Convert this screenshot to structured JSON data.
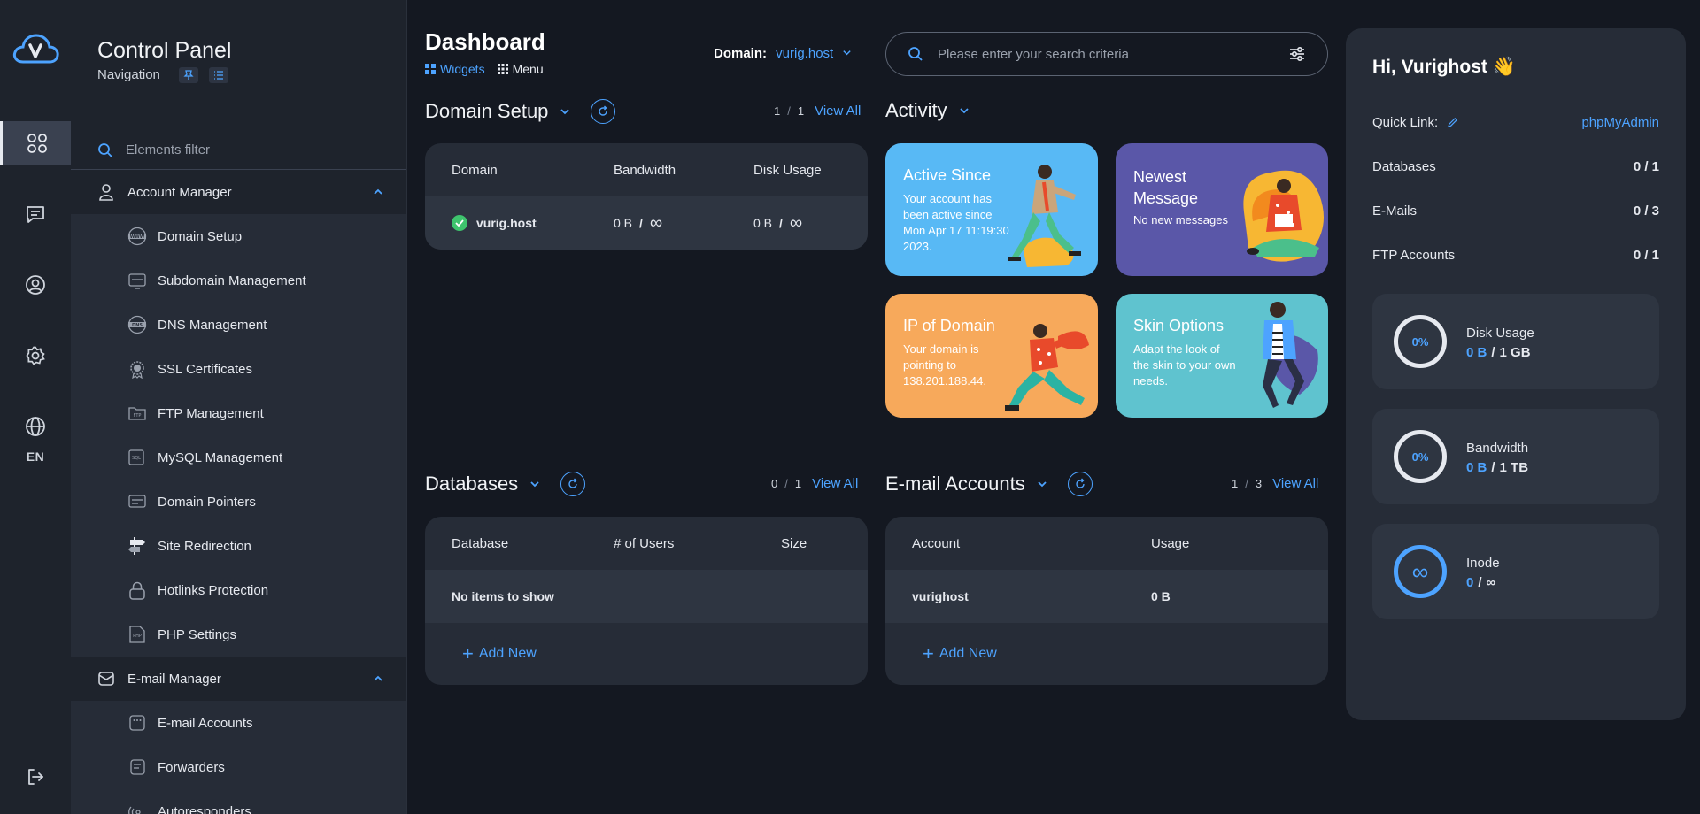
{
  "rail": {
    "lang": "EN"
  },
  "nav": {
    "title": "Control Panel",
    "subtitle": "Navigation",
    "filter_placeholder": "Elements filter",
    "groups": [
      {
        "label": "Account Manager",
        "items": [
          {
            "label": "Domain Setup",
            "icon": "www-icon"
          },
          {
            "label": "Subdomain Management",
            "icon": "subdomain-icon"
          },
          {
            "label": "DNS Management",
            "icon": "dns-icon"
          },
          {
            "label": "SSL Certificates",
            "icon": "ssl-badge-icon"
          },
          {
            "label": "FTP Management",
            "icon": "ftp-folder-icon"
          },
          {
            "label": "MySQL Management",
            "icon": "sql-icon"
          },
          {
            "label": "Domain Pointers",
            "icon": "pointer-icon"
          },
          {
            "label": "Site Redirection",
            "icon": "signpost-icon"
          },
          {
            "label": "Hotlinks Protection",
            "icon": "lock-icon"
          },
          {
            "label": "PHP Settings",
            "icon": "php-icon"
          }
        ]
      },
      {
        "label": "E-mail Manager",
        "items": [
          {
            "label": "E-mail Accounts",
            "icon": "email-accounts-icon"
          },
          {
            "label": "Forwarders",
            "icon": "forwarders-icon"
          },
          {
            "label": "Autoresponders",
            "icon": "autoresponder-icon"
          }
        ]
      }
    ]
  },
  "header": {
    "title": "Dashboard",
    "tab_widgets": "Widgets",
    "tab_menu": "Menu",
    "domain_label": "Domain:",
    "domain_value": "vurig.host",
    "search_placeholder": "Please enter your search criteria"
  },
  "domain_setup": {
    "title": "Domain Setup",
    "count_current": "1",
    "count_sep": "/",
    "count_total": "1",
    "view_all": "View All",
    "columns": [
      "Domain",
      "Bandwidth",
      "Disk Usage"
    ],
    "rows": [
      {
        "domain": "vurig.host",
        "bandwidth": "0 B",
        "bw_sep": "/",
        "bw_limit": "∞",
        "disk": "0 B",
        "disk_sep": "/",
        "disk_limit": "∞"
      }
    ]
  },
  "activity": {
    "title": "Activity",
    "tiles": [
      {
        "title": "Active Since",
        "body": [
          "Your account has",
          "been active since",
          "Mon Apr 17 11:19:30",
          "2023."
        ],
        "color": "#58b9f5"
      },
      {
        "title_lines": [
          "Newest",
          "Message"
        ],
        "body": [
          "No new messages"
        ],
        "color": "#5a57a8"
      },
      {
        "title": "IP of Domain",
        "body": [
          "Your domain is",
          "pointing to",
          "138.201.188.44."
        ],
        "color": "#f7a95b"
      },
      {
        "title": "Skin Options",
        "body": [
          "Adapt the look of",
          "the skin to your own",
          "needs."
        ],
        "color": "#5fc3cf"
      }
    ]
  },
  "databases": {
    "title": "Databases",
    "count_current": "0",
    "count_sep": "/",
    "count_total": "1",
    "view_all": "View All",
    "columns": [
      "Database",
      "# of Users",
      "Size"
    ],
    "empty": "No items to show",
    "add_new": "Add New"
  },
  "email_accounts": {
    "title": "E-mail Accounts",
    "count_current": "1",
    "count_sep": "/",
    "count_total": "3",
    "view_all": "View All",
    "columns": [
      "Account",
      "Usage"
    ],
    "rows": [
      {
        "account": "vurighost",
        "usage": "0 B"
      }
    ],
    "add_new": "Add New"
  },
  "right_panel": {
    "greeting": "Hi, Vurighost 👋",
    "quick_link_label": "Quick Link:",
    "quick_link_value": "phpMyAdmin",
    "stats": [
      {
        "label": "Databases",
        "value": "0 / 1"
      },
      {
        "label": "E-Mails",
        "value": "0 / 3"
      },
      {
        "label": "FTP Accounts",
        "value": "0 / 1"
      }
    ],
    "usage": [
      {
        "ring": "0%",
        "label": "Disk Usage",
        "used": "0 B",
        "sep": "/",
        "limit": "1 GB"
      },
      {
        "ring": "0%",
        "label": "Bandwidth",
        "used": "0 B",
        "sep": "/",
        "limit": "1 TB"
      },
      {
        "ring": "∞",
        "label": "Inode",
        "used": "0",
        "sep": "/",
        "limit": "∞"
      }
    ]
  },
  "colors": {
    "accent": "#4da3ff",
    "success": "#3ec46d"
  }
}
